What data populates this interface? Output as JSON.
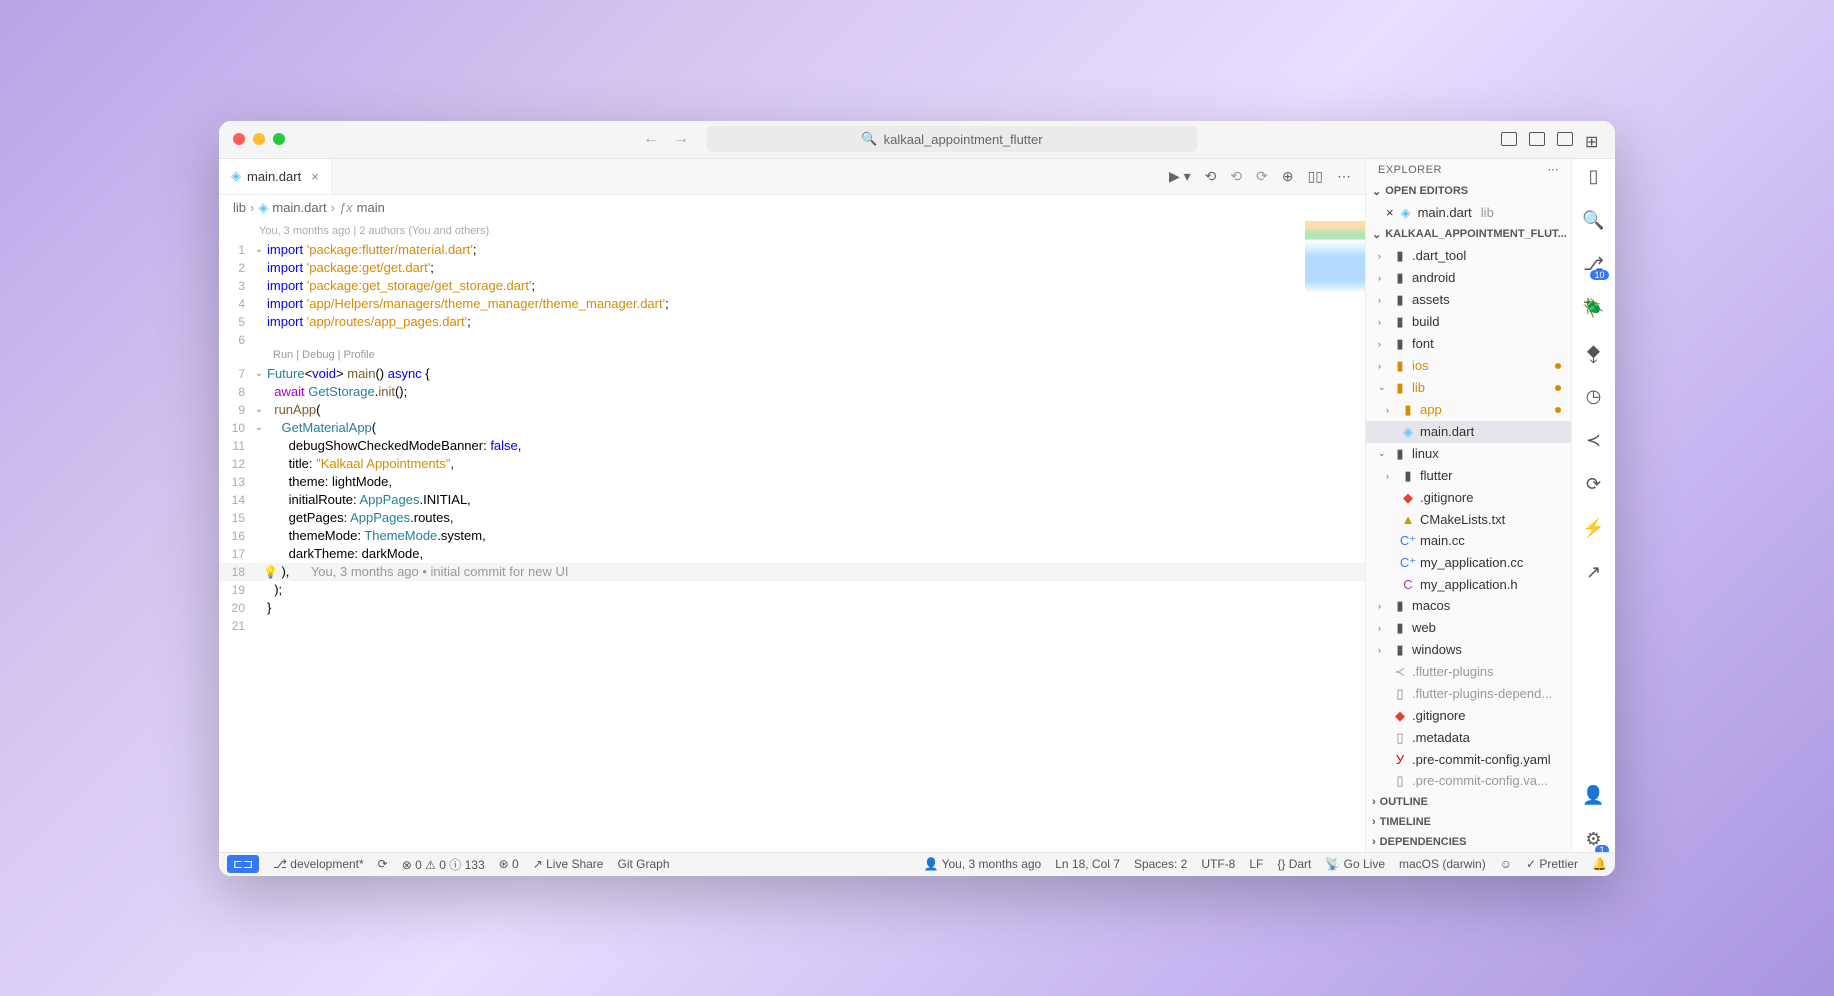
{
  "title": "kalkaal_appointment_flutter",
  "tab": {
    "name": "main.dart",
    "close": "×"
  },
  "breadcrumb": {
    "p1": "lib",
    "p2": "main.dart",
    "p3": "main"
  },
  "blame": "You, 3 months ago | 2 authors (You and others)",
  "codelens": "Run | Debug | Profile",
  "inline_blame": "You, 3 months ago • initial commit for new UI",
  "lines": {
    "l1a": "import",
    "l1b": " 'package:flutter/material.dart'",
    "l1c": ";",
    "l2a": "import",
    "l2b": " 'package:get/get.dart'",
    "l2c": ";",
    "l3a": "import",
    "l3b": " 'package:get_storage/get_storage.dart'",
    "l3c": ";",
    "l4a": "import",
    "l4b": " 'app/Helpers/managers/theme_manager/theme_manager.dart'",
    "l4c": ";",
    "l5a": "import",
    "l5b": " 'app/routes/app_pages.dart'",
    "l5c": ";",
    "l7a": "Future",
    "l7b": "<",
    "l7c": "void",
    "l7d": "> ",
    "l7e": "main",
    "l7f": "() ",
    "l7g": "async",
    "l7h": " {",
    "l8a": "  ",
    "l8b": "await",
    "l8c": " ",
    "l8d": "GetStorage",
    "l8e": ".",
    "l8f": "init",
    "l8g": "();",
    "l9a": "  ",
    "l9b": "runApp",
    "l9c": "(",
    "l10a": "    ",
    "l10b": "GetMaterialApp",
    "l10c": "(",
    "l11a": "      debugShowCheckedModeBanner: ",
    "l11b": "false",
    "l11c": ",",
    "l12a": "      title: ",
    "l12b": "\"Kalkaal Appointments\"",
    "l12c": ",",
    "l13a": "      theme: lightMode,",
    "l14a": "      initialRoute: ",
    "l14b": "AppPages",
    "l14c": ".INITIAL,",
    "l15a": "      getPages: ",
    "l15b": "AppPages",
    "l15c": ".routes,",
    "l16a": "      themeMode: ",
    "l16b": "ThemeMode",
    "l16c": ".system,",
    "l17a": "      darkTheme: darkMode,",
    "l18a": "    ),",
    "l19a": "  );",
    "l20a": "}"
  },
  "explorer": {
    "title": "EXPLORER",
    "open_editors": "OPEN EDITORS",
    "editor_item": "main.dart",
    "editor_path": "lib",
    "root": "KALKAAL_APPOINTMENT_FLUT...",
    "items": {
      "dart_tool": ".dart_tool",
      "android": "android",
      "assets": "assets",
      "build": "build",
      "font": "font",
      "ios": "ios",
      "lib": "lib",
      "app": "app",
      "main_dart": "main.dart",
      "linux": "linux",
      "flutter": "flutter",
      "gitignore": ".gitignore",
      "cmake": "CMakeLists.txt",
      "maincc": "main.cc",
      "myappcc": "my_application.cc",
      "myapph": "my_application.h",
      "macos": "macos",
      "web": "web",
      "windows": "windows",
      "flutter_plugins": ".flutter-plugins",
      "flutter_plugins_d": ".flutter-plugins-depend...",
      "gitignore2": ".gitignore",
      "metadata": ".metadata",
      "precommit": ".pre-commit-config.yaml",
      "precommit2": ".pre-commit-config.va..."
    },
    "outline": "OUTLINE",
    "timeline": "TIMELINE",
    "dependencies": "DEPENDENCIES"
  },
  "status": {
    "remote": "⊞",
    "branch": "development*",
    "sync": "⟳",
    "err": "0",
    "warn": "0",
    "info": "133",
    "dart_err": "0",
    "live": "Live Share",
    "gitgraph": "Git Graph",
    "blame": "You, 3 months ago",
    "pos": "Ln 18, Col 7",
    "spaces": "Spaces: 2",
    "enc": "UTF-8",
    "eol": "LF",
    "lang": "Dart",
    "golive": "Go Live",
    "os": "macOS (darwin)",
    "prettier": "Prettier"
  },
  "scm_badge": "10",
  "settings_badge": "1"
}
